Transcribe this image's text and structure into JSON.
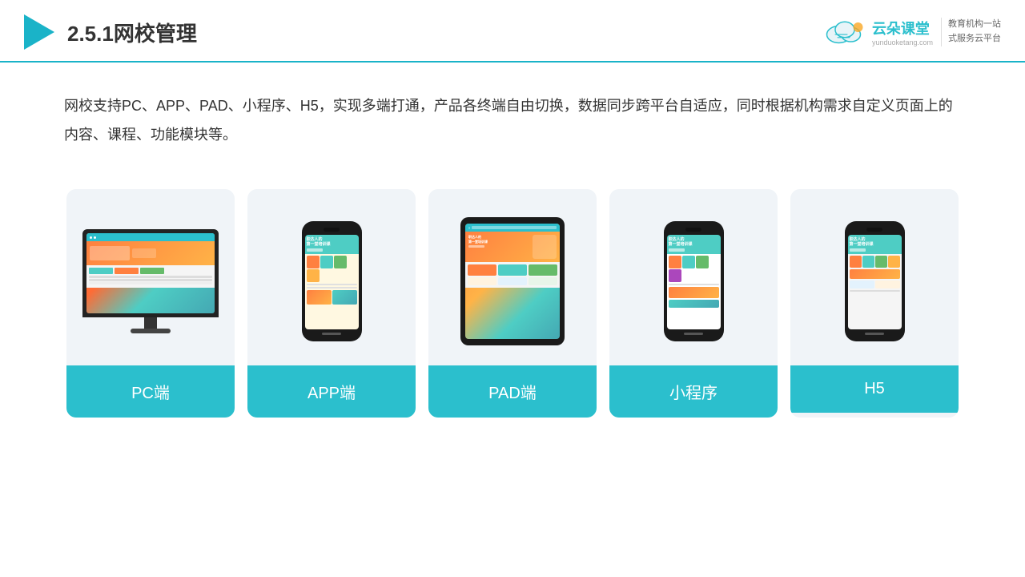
{
  "header": {
    "section_number": "2.5.1",
    "title": "网校管理",
    "brand_name": "云朵课堂",
    "brand_url": "yunduoketang.com",
    "brand_tagline": "教育机构一站\n式服务云平台"
  },
  "description": {
    "text": "网校支持PC、APP、PAD、小程序、H5，实现多端打通，产品各终端自由切换，数据同步跨平台自适应，同时根据机构需求自定义页面上的内容、课程、功能模块等。"
  },
  "cards": [
    {
      "id": "pc",
      "label": "PC端",
      "device": "monitor"
    },
    {
      "id": "app",
      "label": "APP端",
      "device": "phone"
    },
    {
      "id": "pad",
      "label": "PAD端",
      "device": "tablet"
    },
    {
      "id": "miniprogram",
      "label": "小程序",
      "device": "phone"
    },
    {
      "id": "h5",
      "label": "H5",
      "device": "phone"
    }
  ],
  "colors": {
    "accent": "#2bbfcd",
    "header_border": "#1ab3c8",
    "triangle": "#1ab3c8",
    "card_bg": "#f0f4f8",
    "card_label_bg": "#2bbfcd"
  }
}
